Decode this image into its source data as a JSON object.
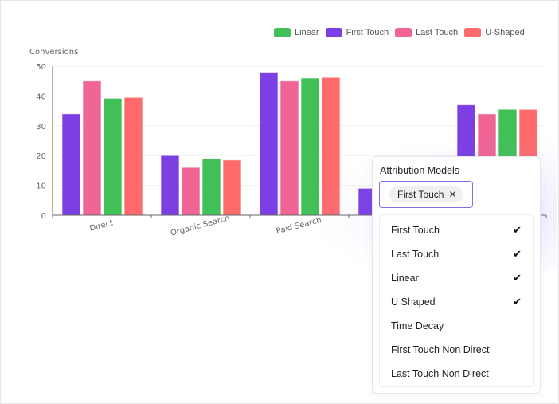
{
  "legend": [
    {
      "label": "Linear",
      "color": "#40c057"
    },
    {
      "label": "First Touch",
      "color": "#7b3fe4"
    },
    {
      "label": "Last Touch",
      "color": "#f06595"
    },
    {
      "label": "U-Shaped",
      "color": "#ff6b6b"
    }
  ],
  "chart_data": {
    "type": "bar",
    "title": "",
    "xlabel": "",
    "ylabel": "Conversions",
    "ylim": [
      0,
      50
    ],
    "yticks": [
      0,
      10,
      20,
      30,
      40,
      50
    ],
    "grid": true,
    "legend_position": "top-right",
    "categories": [
      "Direct",
      "Organic Search",
      "Paid Search",
      "",
      ""
    ],
    "series": [
      {
        "name": "First Touch",
        "color": "#7b3fe4",
        "values": [
          34,
          20,
          48,
          9,
          37
        ]
      },
      {
        "name": "Last Touch",
        "color": "#f06595",
        "values": [
          45,
          16,
          45,
          null,
          34
        ]
      },
      {
        "name": "Linear",
        "color": "#40c057",
        "values": [
          39.2,
          19,
          46,
          null,
          35.5
        ]
      },
      {
        "name": "U-Shaped",
        "color": "#ff6b6b",
        "values": [
          39.5,
          18.5,
          46.2,
          null,
          35.5
        ]
      }
    ]
  },
  "panel": {
    "title": "Attribution Models",
    "selected_pill": "First Touch",
    "pill_remove": "✕",
    "options": [
      {
        "label": "First Touch",
        "checked": true,
        "check": "✔"
      },
      {
        "label": "Last Touch",
        "checked": true,
        "check": "✔"
      },
      {
        "label": "Linear",
        "checked": true,
        "check": "✔"
      },
      {
        "label": "U Shaped",
        "checked": true,
        "check": "✔"
      },
      {
        "label": "Time Decay",
        "checked": false,
        "check": ""
      },
      {
        "label": "First Touch Non Direct",
        "checked": false,
        "check": ""
      },
      {
        "label": "Last Touch Non Direct",
        "checked": false,
        "check": ""
      }
    ]
  }
}
